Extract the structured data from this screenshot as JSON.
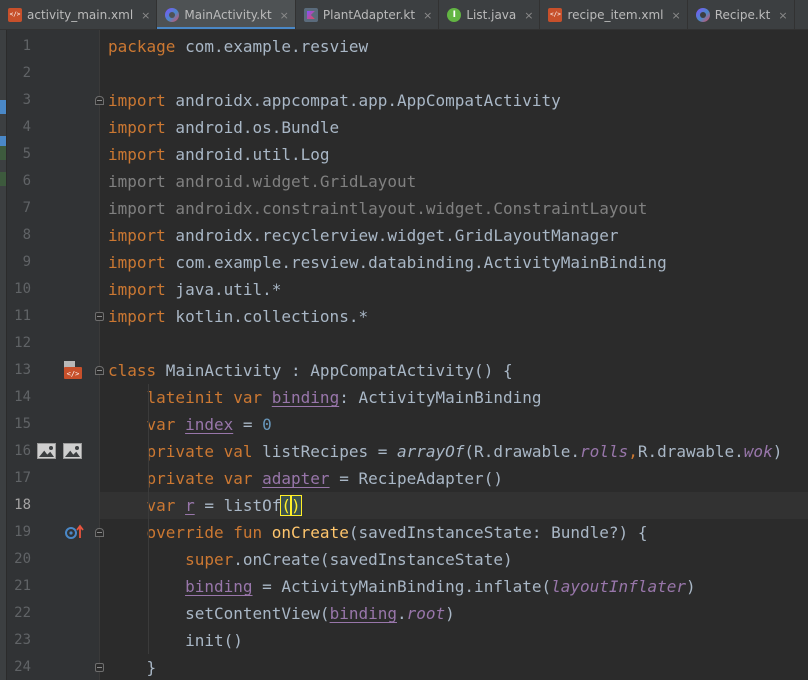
{
  "tabs": [
    {
      "label": "activity_main.xml",
      "icon": "xml-file-icon",
      "active": false
    },
    {
      "label": "MainActivity.kt",
      "icon": "kotlin-class-icon",
      "active": true
    },
    {
      "label": "PlantAdapter.kt",
      "icon": "kotlin-file-icon",
      "active": false
    },
    {
      "label": "List.java",
      "icon": "java-interface-icon",
      "active": false
    },
    {
      "label": "recipe_item.xml",
      "icon": "xml-file-icon",
      "active": false
    },
    {
      "label": "Recipe.kt",
      "icon": "kotlin-class-icon",
      "active": false
    }
  ],
  "editor": {
    "current_line": 18,
    "lines": [
      {
        "n": "1",
        "tokens": [
          [
            "kw",
            "package"
          ],
          [
            "def",
            " com.example.resview"
          ]
        ]
      },
      {
        "n": "2",
        "tokens": []
      },
      {
        "n": "3",
        "tokens": [
          [
            "kw",
            "import"
          ],
          [
            "def",
            " androidx.appcompat.app.AppCompatActivity"
          ]
        ]
      },
      {
        "n": "4",
        "tokens": [
          [
            "kw",
            "import"
          ],
          [
            "def",
            " android.os.Bundle"
          ]
        ]
      },
      {
        "n": "5",
        "tokens": [
          [
            "kw",
            "import"
          ],
          [
            "def",
            " android.util.Log"
          ]
        ]
      },
      {
        "n": "6",
        "tokens": [
          [
            "un",
            "import android.widget.GridLayout"
          ]
        ]
      },
      {
        "n": "7",
        "tokens": [
          [
            "un",
            "import androidx.constraintlayout.widget.ConstraintLayout"
          ]
        ]
      },
      {
        "n": "8",
        "tokens": [
          [
            "kw",
            "import"
          ],
          [
            "def",
            " androidx.recyclerview.widget.GridLayoutManager"
          ]
        ]
      },
      {
        "n": "9",
        "tokens": [
          [
            "kw",
            "import"
          ],
          [
            "def",
            " com.example.resview.databinding.ActivityMainBinding"
          ]
        ]
      },
      {
        "n": "10",
        "tokens": [
          [
            "kw",
            "import"
          ],
          [
            "def",
            " java.util.*"
          ]
        ]
      },
      {
        "n": "11",
        "tokens": [
          [
            "kw",
            "import"
          ],
          [
            "def",
            " kotlin.collections.*"
          ]
        ]
      },
      {
        "n": "12",
        "tokens": []
      },
      {
        "n": "13",
        "tokens": [
          [
            "kw",
            "class"
          ],
          [
            "def",
            " MainActivity : AppCompatActivity() {"
          ]
        ]
      },
      {
        "n": "14",
        "tokens": [
          [
            "def",
            "    "
          ],
          [
            "kw",
            "lateinit var "
          ],
          [
            "prop",
            "binding"
          ],
          [
            "def",
            ": ActivityMainBinding"
          ]
        ]
      },
      {
        "n": "15",
        "tokens": [
          [
            "def",
            "    "
          ],
          [
            "kw",
            "var "
          ],
          [
            "prop",
            "index"
          ],
          [
            "def",
            " = "
          ],
          [
            "num",
            "0"
          ]
        ]
      },
      {
        "n": "16",
        "tokens": [
          [
            "def",
            "    "
          ],
          [
            "kw",
            "private val "
          ],
          [
            "def",
            "listRecipes = "
          ],
          [
            "call",
            "arrayOf"
          ],
          [
            "def",
            "(R.drawable."
          ],
          [
            "propi",
            "rolls"
          ],
          [
            "kw",
            ","
          ],
          [
            "def",
            "R.drawable."
          ],
          [
            "propi",
            "wok"
          ],
          [
            "def",
            ")"
          ]
        ]
      },
      {
        "n": "17",
        "tokens": [
          [
            "def",
            "    "
          ],
          [
            "kw",
            "private var "
          ],
          [
            "prop",
            "adapter"
          ],
          [
            "def",
            " = RecipeAdapter()"
          ]
        ]
      },
      {
        "n": "18",
        "tokens": [
          [
            "def",
            "    "
          ],
          [
            "kw",
            "var "
          ],
          [
            "prop",
            "r"
          ],
          [
            "def",
            " = "
          ],
          [
            "def",
            "listOf"
          ],
          [
            "paren",
            "("
          ],
          [
            "caret",
            ""
          ],
          [
            "paren",
            ")"
          ]
        ]
      },
      {
        "n": "19",
        "tokens": [
          [
            "def",
            "    "
          ],
          [
            "kw",
            "override fun "
          ],
          [
            "fn",
            "onCreate"
          ],
          [
            "def",
            "(savedInstanceState: Bundle?) {"
          ]
        ]
      },
      {
        "n": "20",
        "tokens": [
          [
            "def",
            "        "
          ],
          [
            "kw",
            "super"
          ],
          [
            "def",
            ".onCreate(savedInstanceState)"
          ]
        ]
      },
      {
        "n": "21",
        "tokens": [
          [
            "def",
            "        "
          ],
          [
            "prop",
            "binding"
          ],
          [
            "def",
            " = ActivityMainBinding.inflate("
          ],
          [
            "propi",
            "layoutInflater"
          ],
          [
            "def",
            ")"
          ]
        ]
      },
      {
        "n": "22",
        "tokens": [
          [
            "def",
            "        setContentView("
          ],
          [
            "prop",
            "binding"
          ],
          [
            "def",
            "."
          ],
          [
            "propi",
            "root"
          ],
          [
            "def",
            ")"
          ]
        ]
      },
      {
        "n": "23",
        "tokens": [
          [
            "def",
            "        init()"
          ]
        ]
      },
      {
        "n": "24",
        "tokens": [
          [
            "def",
            "    }"
          ]
        ]
      }
    ]
  },
  "gutter_icons": [
    {
      "line": "13",
      "icon": "layout-file-icon"
    },
    {
      "line": "16",
      "icon": "image-preview-icon"
    },
    {
      "line": "16",
      "icon": "image-preview-icon"
    },
    {
      "line": "19",
      "icon": "override-method-icon"
    }
  ],
  "colors": {
    "background": "#2b2b2b",
    "keyword": "#cc7832",
    "property": "#9876aa",
    "function": "#ffc66d",
    "number": "#6897bb",
    "text": "#a9b7c6",
    "active_tab_underline": "#4a88c7"
  }
}
